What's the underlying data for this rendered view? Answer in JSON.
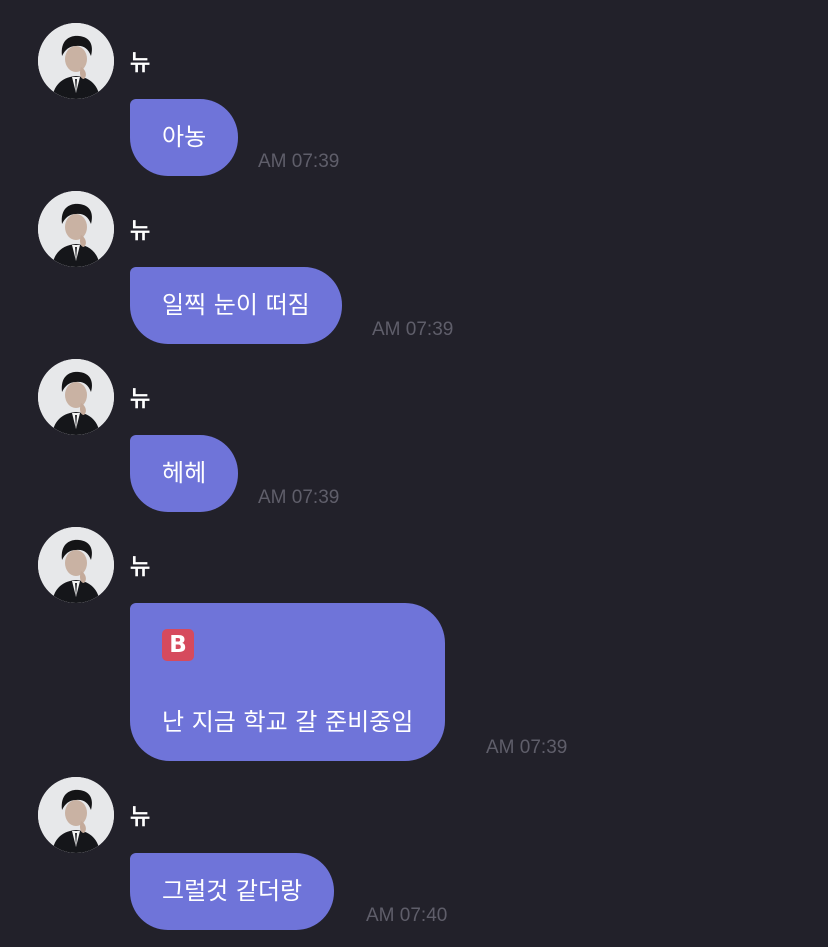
{
  "messages": [
    {
      "sender": "뉴",
      "text": "아농",
      "time": "AM 07:39"
    },
    {
      "sender": "뉴",
      "text": "일찍 눈이 떠짐",
      "time": "AM 07:39"
    },
    {
      "sender": "뉴",
      "text": "헤헤",
      "time": "AM 07:39"
    },
    {
      "sender": "뉴",
      "badge": "B",
      "text": "난 지금 학교 갈 준비중임",
      "time": "AM 07:39"
    },
    {
      "sender": "뉴",
      "text": "그럴것 같더랑",
      "time": "AM 07:40"
    }
  ],
  "colors": {
    "background": "#22212a",
    "bubble": "#6f74d9",
    "timestamp": "#5f5e6a",
    "badge": "#d64a5d"
  }
}
